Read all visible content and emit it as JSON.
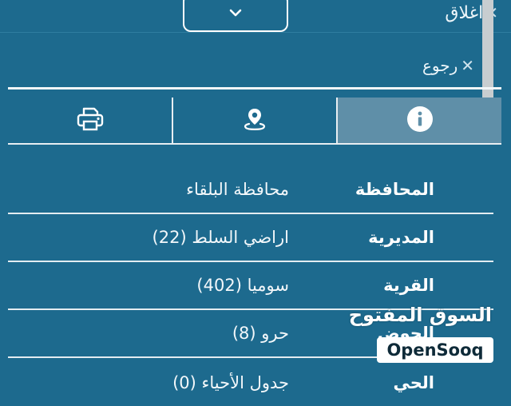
{
  "header": {
    "close_label": "اغلاق",
    "back_label": "رجوع",
    "collapse_icon": "chevron-down-icon"
  },
  "tabs": [
    {
      "icon": "print-icon",
      "active": false
    },
    {
      "icon": "location-pin-icon",
      "active": false
    },
    {
      "icon": "info-icon",
      "active": true
    }
  ],
  "details": [
    {
      "label": "المحافظة",
      "value": "محافظة البلقاء"
    },
    {
      "label": "المديرية",
      "value": "اراضي السلط (22)"
    },
    {
      "label": "القرية",
      "value": "سوميا (402)"
    },
    {
      "label": "الحوض",
      "value": "حرو (8)"
    },
    {
      "label": "الحي",
      "value": "جدول الأحياء (0)"
    }
  ],
  "watermark": {
    "arabic": "السوق المفتوح",
    "english": "OpenSooq"
  },
  "colors": {
    "background": "#1d6a8e",
    "active_tab": "#5f8fa8",
    "text": "#ffffff"
  }
}
